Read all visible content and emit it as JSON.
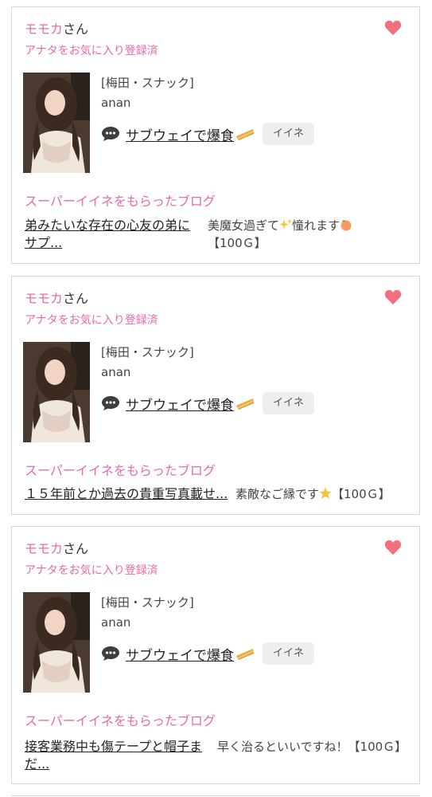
{
  "colors": {
    "accent_pink": "#e86aa8",
    "heart": "#f07080",
    "card_border": "#d6d6d6"
  },
  "cards": [
    {
      "user_name": "モモカ",
      "honorific": "さん",
      "favorite_status": "アナタをお気に入り登録済",
      "shop": "[梅田・スナック]",
      "cast_name": "anan",
      "blog_title": "サブウェイで爆食",
      "iine_label": "イイネ",
      "super_title": "スーパーイイネをもらったブログ",
      "post_title": "弟みたいな存在の心友の弟にサプ...",
      "comment": "美魔女過ぎて",
      "comment_mid": "憧れます",
      "comment_end": "【100Ｇ】"
    },
    {
      "user_name": "モモカ",
      "honorific": "さん",
      "favorite_status": "アナタをお気に入り登録済",
      "shop": "[梅田・スナック]",
      "cast_name": "anan",
      "blog_title": "サブウェイで爆食",
      "iine_label": "イイネ",
      "super_title": "スーパーイイネをもらったブログ",
      "post_title": "１５年前とか過去の貴重写真載せ...",
      "comment": "素敵なご縁です",
      "comment_end": "【100Ｇ】"
    },
    {
      "user_name": "モモカ",
      "honorific": "さん",
      "favorite_status": "アナタをお気に入り登録済",
      "shop": "[梅田・スナック]",
      "cast_name": "anan",
      "blog_title": "サブウェイで爆食",
      "iine_label": "イイネ",
      "super_title": "スーパーイイネをもらったブログ",
      "post_title": "接客業務中も傷テープと帽子まだ...",
      "comment": "早く治るといいですね！【100Ｇ】"
    }
  ]
}
